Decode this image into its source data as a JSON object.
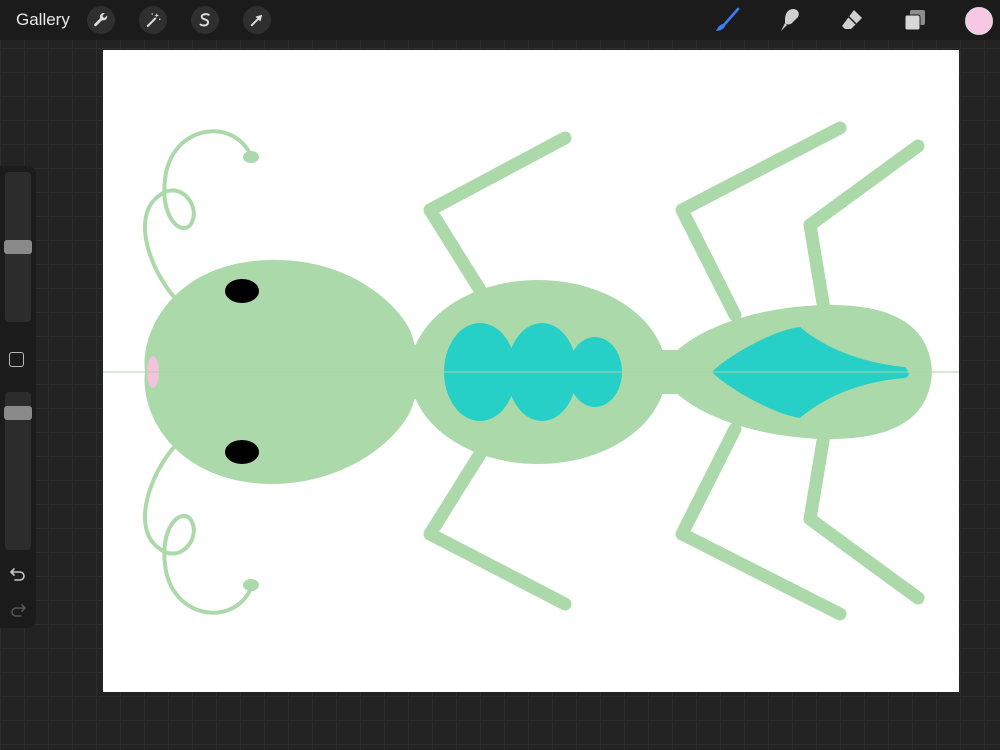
{
  "toolbar": {
    "gallery_label": "Gallery",
    "left_tools": [
      {
        "icon": "wrench-icon",
        "name": "actions"
      },
      {
        "icon": "magic-wand-icon",
        "name": "adjustments"
      },
      {
        "icon": "selection-s-icon",
        "name": "selection"
      },
      {
        "icon": "arrow-cursor-icon",
        "name": "transform"
      }
    ],
    "right_tools": [
      {
        "icon": "brush-icon",
        "name": "paint",
        "active": true
      },
      {
        "icon": "smudge-icon",
        "name": "smudge"
      },
      {
        "icon": "eraser-icon",
        "name": "eraser"
      },
      {
        "icon": "layers-icon",
        "name": "layers"
      }
    ],
    "current_color": "#f6c8e4",
    "active_tool_color": "#3d7ff2"
  },
  "sidebar": {
    "brush_size_level": 0.5,
    "opacity_level": 0.9,
    "modify_icon": "square-outline-icon",
    "undo_icon": "undo-icon",
    "redo_icon": "redo-icon"
  },
  "canvas": {
    "background": "#ffffff",
    "colors": {
      "body": "#acd9aa",
      "accent": "#26d0c7",
      "eye": "#000000",
      "mouth": "#f4c2dc",
      "symmetry_guide": "#a6d4aa"
    },
    "subject": "ant-drawing"
  }
}
